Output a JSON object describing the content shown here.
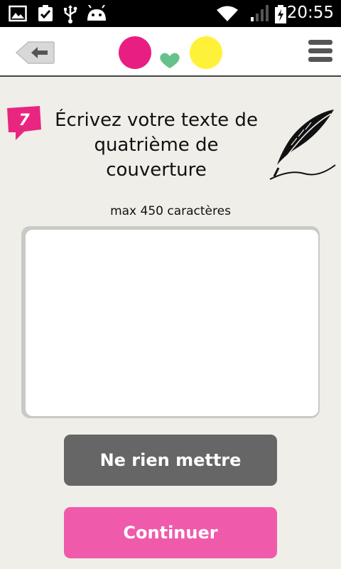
{
  "status_bar": {
    "time": "20:55",
    "icons": [
      "image-icon",
      "clipboard-check-icon",
      "usb-icon",
      "android-icon",
      "wifi-icon",
      "signal-icon",
      "battery-charging-icon"
    ]
  },
  "app_bar": {
    "back_icon": "back-arrow-icon",
    "logo_colors": [
      "#e91e83",
      "#66c28a",
      "#fff13a"
    ],
    "menu_icon": "hamburger-menu-icon"
  },
  "step": {
    "number": "7",
    "color": "#e9267f",
    "title": "Écrivez votre texte de quatrième de couverture",
    "decoration": "quill-icon"
  },
  "input": {
    "hint": "max 450 caractères",
    "value": "",
    "placeholder": ""
  },
  "buttons": {
    "skip_label": "Ne rien mettre",
    "skip_color": "#666666",
    "continue_label": "Continuer",
    "continue_color": "#f05aab"
  }
}
